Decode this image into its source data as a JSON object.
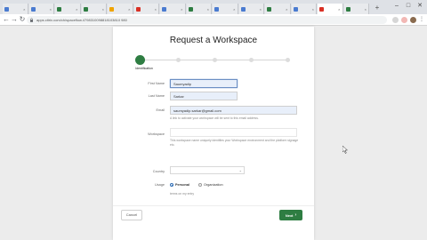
{
  "browser": {
    "tabs": [
      {
        "label": "",
        "color": "#4a7bd0"
      },
      {
        "label": "",
        "color": "#4a7bd0"
      },
      {
        "label": "",
        "color": "#2e7d42"
      },
      {
        "label": "",
        "color": "#2e7d42"
      },
      {
        "label": "",
        "color": "#f0a400"
      },
      {
        "label": "",
        "color": "#d93025"
      },
      {
        "label": "",
        "color": "#4a7bd0"
      },
      {
        "label": "",
        "color": "#2e7d42"
      },
      {
        "label": "",
        "color": "#4a7bd0"
      },
      {
        "label": "",
        "color": "#4a7bd0"
      },
      {
        "label": "",
        "color": "#2e7d42"
      },
      {
        "label": "",
        "color": "#4a7bd0"
      },
      {
        "label": "",
        "color": "#d93025"
      },
      {
        "label": "",
        "color": "#2e7d42"
      }
    ],
    "new_tab_glyph": "+",
    "min_glyph": "–",
    "max_glyph": "□",
    "close_glyph": "✕",
    "back_glyph": "←",
    "forward_glyph": "→",
    "reload_glyph": "↻",
    "url": "apps.citrix.com/ch/spaceflow.4798310098818103810 980"
  },
  "form": {
    "title": "Request a Workspace",
    "accent_color": "#2e7d42",
    "step_label": "Identification",
    "first_name_label": "First Name",
    "first_name_value": "Saumyadip",
    "last_name_label": "Last Name",
    "last_name_value": "Sarkar",
    "email_label": "Email",
    "email_value": "saumyadip.sarkar@gmail.com",
    "email_helper": "A link to activate your workspace will be sent to this email address.",
    "workspace_label": "Workspace",
    "workspace_helper": "This workspace name uniquely identifies your Workspace environment and the platform signage etc.",
    "country_label": "Country",
    "usage_label": "Usage",
    "usage_options": [
      "Personal",
      "Organization"
    ],
    "usage_selected": "Personal",
    "usage_helper": "terms on my entry",
    "cancel_label": "Cancel",
    "next_label": "Next"
  }
}
